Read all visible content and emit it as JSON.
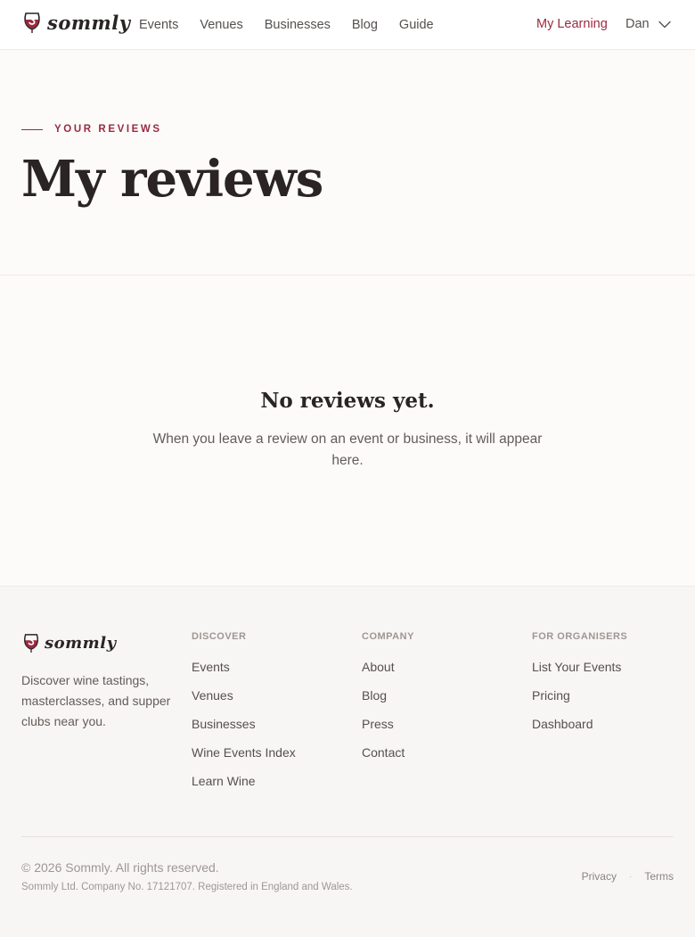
{
  "brand": {
    "name": "sommly",
    "accent_color": "#9a2a40"
  },
  "nav": {
    "links": [
      "Events",
      "Venues",
      "Businesses",
      "Blog",
      "Guide"
    ],
    "my_learning": "My Learning",
    "user_name": "Dan"
  },
  "hero": {
    "eyebrow": "YOUR REVIEWS",
    "title": "My reviews"
  },
  "empty_state": {
    "title": "No reviews yet.",
    "text": "When you leave a review on an event or business, it will appear here."
  },
  "footer": {
    "tagline": "Discover wine tastings, masterclasses, and supper clubs near you.",
    "columns": [
      {
        "heading": "DISCOVER",
        "links": [
          "Events",
          "Venues",
          "Businesses",
          "Wine Events Index",
          "Learn Wine"
        ]
      },
      {
        "heading": "COMPANY",
        "links": [
          "About",
          "Blog",
          "Press",
          "Contact"
        ]
      },
      {
        "heading": "FOR ORGANISERS",
        "links": [
          "List Your Events",
          "Pricing",
          "Dashboard"
        ]
      }
    ],
    "copyright": "© 2026 Sommly. All rights reserved.",
    "company_info": "Sommly Ltd. Company No. 17121707. Registered in England and Wales.",
    "legal_links": [
      "Privacy",
      "Terms"
    ],
    "legal_separator": "·"
  },
  "icons": {
    "logo": "wine-glass-s-icon",
    "user_menu": "chevron-down-icon"
  }
}
